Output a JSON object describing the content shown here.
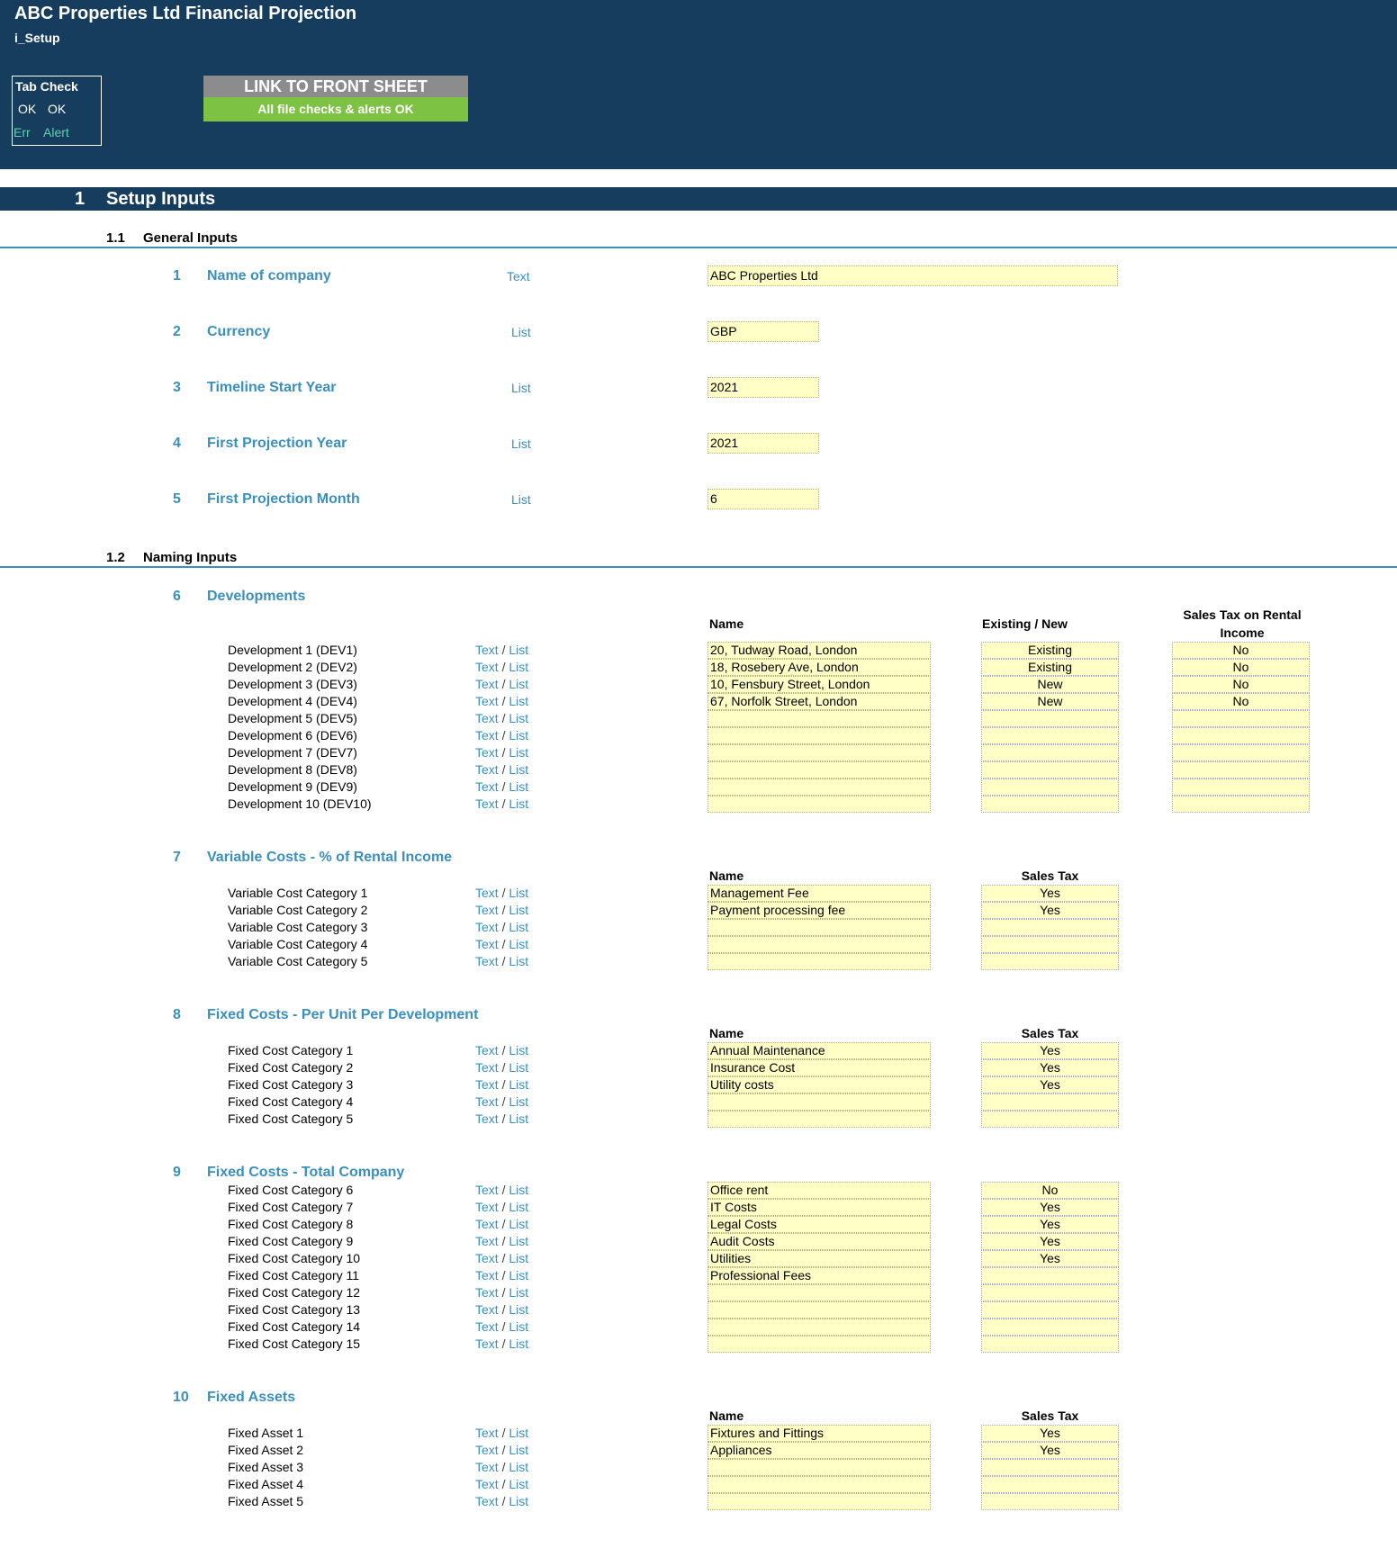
{
  "header": {
    "title": "ABC Properties Ltd Financial Projection",
    "sheet": "i_Setup",
    "tab_check": {
      "title": "Tab Check",
      "ok1": "OK",
      "ok2": "OK",
      "err": "Err",
      "alert": "Alert"
    },
    "link_button": "LINK TO FRONT SHEET",
    "status": "All file checks & alerts OK"
  },
  "section": {
    "number": "1",
    "title": "Setup Inputs"
  },
  "general": {
    "number": "1.1",
    "title": "General Inputs",
    "items": [
      {
        "num": "1",
        "label": "Name of company",
        "type": "Text",
        "value": "ABC Properties Ltd"
      },
      {
        "num": "2",
        "label": "Currency",
        "type": "List",
        "value": "GBP"
      },
      {
        "num": "3",
        "label": "Timeline Start Year",
        "type": "List",
        "value": "2021"
      },
      {
        "num": "4",
        "label": "First Projection Year",
        "type": "List",
        "value": "2021"
      },
      {
        "num": "5",
        "label": "First Projection Month",
        "type": "List",
        "value": "6"
      }
    ]
  },
  "naming": {
    "number": "1.2",
    "title": "Naming Inputs"
  },
  "type_labels": {
    "text": "Text",
    "sep": " / ",
    "list": "List"
  },
  "developments": {
    "num": "6",
    "title": "Developments",
    "headers": {
      "name": "Name",
      "existing": "Existing / New",
      "tax1": "Sales Tax on Rental",
      "tax2": "Income"
    },
    "rows": [
      {
        "label": "Development 1 (DEV1)",
        "name": "20, Tudway Road, London",
        "existing": "Existing",
        "tax": "No"
      },
      {
        "label": "Development 2 (DEV2)",
        "name": "18, Rosebery Ave, London",
        "existing": "Existing",
        "tax": "No"
      },
      {
        "label": "Development 3 (DEV3)",
        "name": "10, Fensbury Street, London",
        "existing": "New",
        "tax": "No"
      },
      {
        "label": "Development 4 (DEV4)",
        "name": "67, Norfolk Street, London",
        "existing": "New",
        "tax": "No"
      },
      {
        "label": "Development 5 (DEV5)",
        "name": "",
        "existing": "",
        "tax": ""
      },
      {
        "label": "Development 6 (DEV6)",
        "name": "",
        "existing": "",
        "tax": ""
      },
      {
        "label": "Development 7 (DEV7)",
        "name": "",
        "existing": "",
        "tax": ""
      },
      {
        "label": "Development 8 (DEV8)",
        "name": "",
        "existing": "",
        "tax": ""
      },
      {
        "label": "Development 9 (DEV9)",
        "name": "",
        "existing": "",
        "tax": ""
      },
      {
        "label": "Development 10 (DEV10)",
        "name": "",
        "existing": "",
        "tax": ""
      }
    ]
  },
  "variable_costs": {
    "num": "7",
    "title": "Variable Costs - % of Rental Income",
    "headers": {
      "name": "Name",
      "tax": "Sales Tax"
    },
    "rows": [
      {
        "label": "Variable Cost Category 1",
        "name": "Management Fee",
        "tax": "Yes"
      },
      {
        "label": "Variable Cost Category 2",
        "name": "Payment processing fee",
        "tax": "Yes"
      },
      {
        "label": "Variable Cost Category 3",
        "name": "",
        "tax": ""
      },
      {
        "label": "Variable Cost Category 4",
        "name": "",
        "tax": ""
      },
      {
        "label": "Variable Cost Category 5",
        "name": "",
        "tax": ""
      }
    ]
  },
  "fixed_unit": {
    "num": "8",
    "title": "Fixed Costs - Per Unit Per Development",
    "headers": {
      "name": "Name",
      "tax": "Sales Tax"
    },
    "rows": [
      {
        "label": "Fixed Cost Category 1",
        "name": "Annual Maintenance",
        "tax": "Yes"
      },
      {
        "label": "Fixed Cost Category 2",
        "name": "Insurance Cost",
        "tax": "Yes"
      },
      {
        "label": "Fixed Cost Category 3",
        "name": "Utility costs",
        "tax": "Yes"
      },
      {
        "label": "Fixed Cost Category 4",
        "name": "",
        "tax": ""
      },
      {
        "label": "Fixed Cost Category 5",
        "name": "",
        "tax": ""
      }
    ]
  },
  "fixed_company": {
    "num": "9",
    "title": "Fixed Costs - Total Company",
    "rows": [
      {
        "label": "Fixed Cost Category 6",
        "name": "Office rent",
        "tax": "No"
      },
      {
        "label": "Fixed Cost Category 7",
        "name": "IT Costs",
        "tax": "Yes"
      },
      {
        "label": "Fixed Cost Category 8",
        "name": "Legal Costs",
        "tax": "Yes"
      },
      {
        "label": "Fixed Cost Category 9",
        "name": "Audit Costs",
        "tax": "Yes"
      },
      {
        "label": "Fixed Cost Category 10",
        "name": "Utilities",
        "tax": "Yes"
      },
      {
        "label": "Fixed Cost Category 11",
        "name": "Professional Fees",
        "tax": ""
      },
      {
        "label": "Fixed Cost Category 12",
        "name": "",
        "tax": ""
      },
      {
        "label": "Fixed Cost Category 13",
        "name": "",
        "tax": ""
      },
      {
        "label": "Fixed Cost Category 14",
        "name": "",
        "tax": ""
      },
      {
        "label": "Fixed Cost Category 15",
        "name": "",
        "tax": ""
      }
    ]
  },
  "fixed_assets": {
    "num": "10",
    "title": "Fixed Assets",
    "headers": {
      "name": "Name",
      "tax": "Sales Tax"
    },
    "rows": [
      {
        "label": "Fixed Asset 1",
        "name": "Fixtures and Fittings",
        "tax": "Yes"
      },
      {
        "label": "Fixed Asset 2",
        "name": "Appliances",
        "tax": "Yes"
      },
      {
        "label": "Fixed Asset 3",
        "name": "",
        "tax": ""
      },
      {
        "label": "Fixed Asset 4",
        "name": "",
        "tax": ""
      },
      {
        "label": "Fixed Asset 5",
        "name": "",
        "tax": ""
      }
    ]
  },
  "colors": {
    "banner": "#173d5e",
    "accent": "#3a8fbd",
    "input_fill": "#ffffc6",
    "ok_green": "#7dc242",
    "link_grey": "#8c8c8c",
    "alert_teal": "#5fd1b2"
  }
}
